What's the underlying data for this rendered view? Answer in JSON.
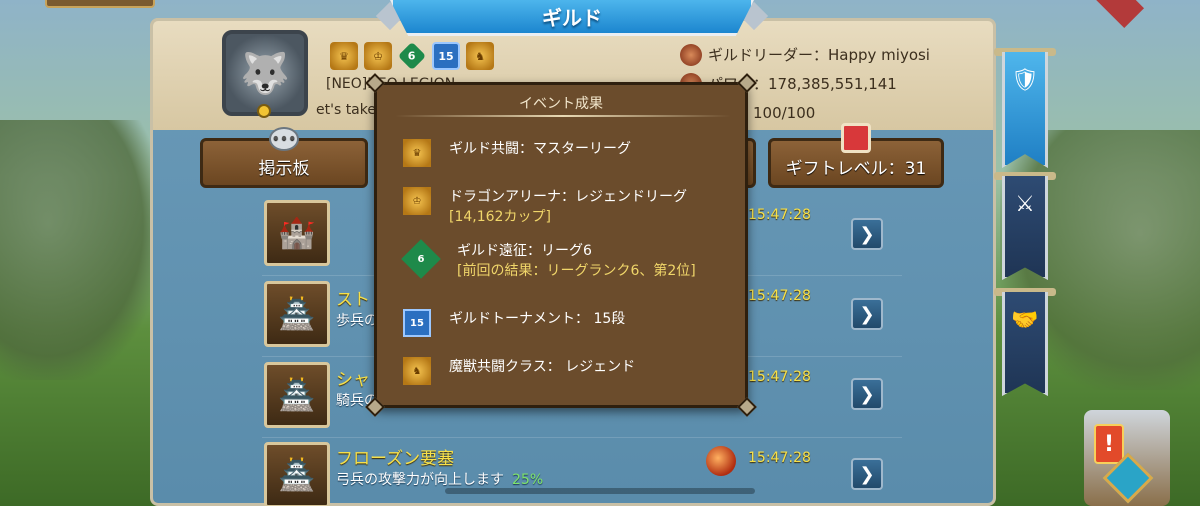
{
  "window": {
    "title": "ギルド"
  },
  "guild": {
    "tag_name": "[NEO]NEO LEGION",
    "motto": "et's take",
    "leader_line": "ギルドリーダー：Happy miyosi",
    "power_line": "パワー：178,385,551,141",
    "members_line": "バー：100/100",
    "badge_numbers": [
      "6",
      "15"
    ]
  },
  "buttons": {
    "board": "掲示板",
    "gift_level": "ギフトレベル：31"
  },
  "rows": [
    {
      "title": "",
      "desc": "",
      "pct": "",
      "time": "15:47:28"
    },
    {
      "title": "スト",
      "desc": "歩兵の",
      "pct": "",
      "time": "15:47:28"
    },
    {
      "title": "シャ",
      "desc": "騎兵の",
      "pct": "",
      "time": "15:47:28"
    },
    {
      "title": "フローズン要塞",
      "desc": "弓兵の攻撃力が向上します",
      "pct": "25%",
      "time": "15:47:28"
    }
  ],
  "popup": {
    "title": "イベント成果",
    "items": [
      {
        "text": "ギルド共闘：マスターリーグ",
        "sub": "",
        "sub2": ""
      },
      {
        "text": "ドラゴンアリーナ：レジェンドリーグ",
        "sub": "[14,162カップ]",
        "sub2": ""
      },
      {
        "text": "ギルド遠征：リーグ6",
        "sub": "[前回の結果：リーグランク6、第2位]",
        "sub2": ""
      },
      {
        "text": "ギルドトーナメント： 15段",
        "sub": "",
        "sub2": ""
      },
      {
        "text": "魔獣共闘クラス： レジェンド",
        "sub": "",
        "sub2": ""
      }
    ],
    "icon_labels": [
      "",
      "",
      "6",
      "15",
      ""
    ]
  },
  "colors": {
    "title_blue": "#1c86cf",
    "popup_brown": "#6b4c2c",
    "time_yellow": "#f6e04a",
    "pct_green": "#7fe36b"
  }
}
